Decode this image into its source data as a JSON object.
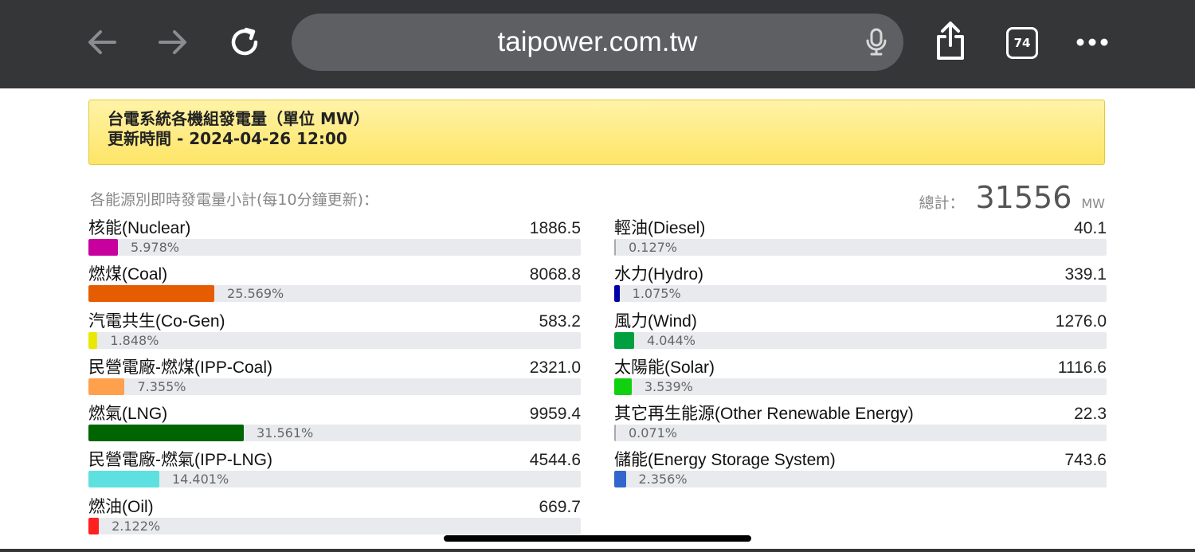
{
  "browser": {
    "url": "taipower.com.tw",
    "tab_count": "74"
  },
  "banner": {
    "title": "台電系統各機組發電量（單位 MW）",
    "updated": "更新時間 - 2024-04-26 12:00"
  },
  "summary": {
    "subtitle": "各能源別即時發電量小計(每10分鐘更新)：",
    "total_label": "總計：",
    "total_value": "31556",
    "total_unit": "MW"
  },
  "left_items": [
    {
      "name": "核能(Nuclear)",
      "value": "1886.5",
      "percent": "5.978%",
      "fraction": 0.05978,
      "color": "#c8009e"
    },
    {
      "name": "燃煤(Coal)",
      "value": "8068.8",
      "percent": "25.569%",
      "fraction": 0.25569,
      "color": "#e65c00"
    },
    {
      "name": "汽電共生(Co-Gen)",
      "value": "583.2",
      "percent": "1.848%",
      "fraction": 0.01848,
      "color": "#e8e800"
    },
    {
      "name": "民營電廠-燃煤(IPP-Coal)",
      "value": "2321.0",
      "percent": "7.355%",
      "fraction": 0.07355,
      "color": "#ffa04d"
    },
    {
      "name": "燃氣(LNG)",
      "value": "9959.4",
      "percent": "31.561%",
      "fraction": 0.31561,
      "color": "#006400"
    },
    {
      "name": "民營電廠-燃氣(IPP-LNG)",
      "value": "4544.6",
      "percent": "14.401%",
      "fraction": 0.14401,
      "color": "#5ee0e0"
    },
    {
      "name": "燃油(Oil)",
      "value": "669.7",
      "percent": "2.122%",
      "fraction": 0.02122,
      "color": "#ff2020"
    }
  ],
  "right_items": [
    {
      "name": "輕油(Diesel)",
      "value": "40.1",
      "percent": "0.127%",
      "fraction": 0.00127,
      "color": "#aaaaaa"
    },
    {
      "name": "水力(Hydro)",
      "value": "339.1",
      "percent": "1.075%",
      "fraction": 0.01075,
      "color": "#0000a8"
    },
    {
      "name": "風力(Wind)",
      "value": "1276.0",
      "percent": "4.044%",
      "fraction": 0.04044,
      "color": "#00a040"
    },
    {
      "name": "太陽能(Solar)",
      "value": "1116.6",
      "percent": "3.539%",
      "fraction": 0.03539,
      "color": "#10d010"
    },
    {
      "name": "其它再生能源(Other Renewable Energy)",
      "value": "22.3",
      "percent": "0.071%",
      "fraction": 0.00071,
      "color": "#aaaaaa"
    },
    {
      "name": "儲能(Energy Storage System)",
      "value": "743.6",
      "percent": "2.356%",
      "fraction": 0.02356,
      "color": "#3366cc"
    }
  ],
  "icons": {
    "back": "arrow-left-icon",
    "forward": "arrow-right-icon",
    "reload": "reload-icon",
    "mic": "microphone-icon",
    "share": "share-icon",
    "more": "more-dots-icon"
  }
}
